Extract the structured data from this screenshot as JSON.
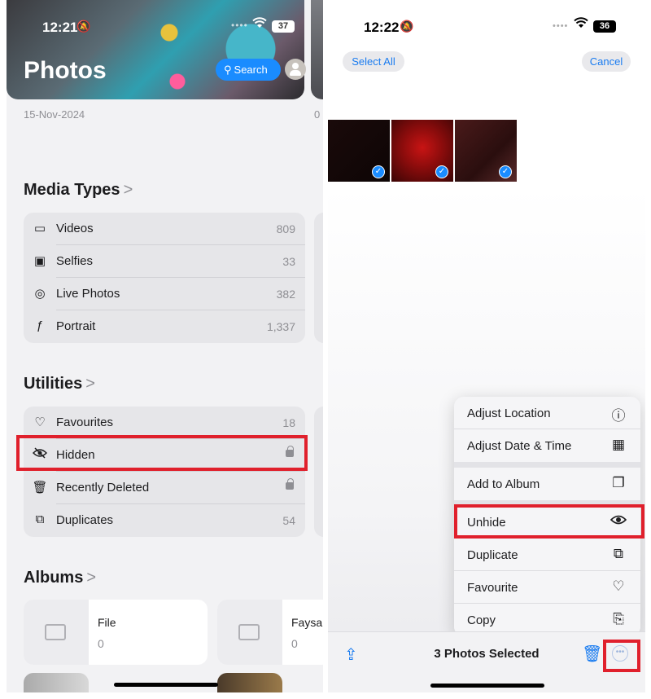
{
  "left": {
    "status_time": "12:21",
    "status_battery": "37",
    "title": "Photos",
    "search_label": "Search",
    "date_left": "15-Nov-2024",
    "date_right": "0",
    "media_types": {
      "title": "Media Types",
      "chevron": ">",
      "items": [
        {
          "label": "Videos",
          "value": "809",
          "icon": "video-icon"
        },
        {
          "label": "Selfies",
          "value": "33",
          "icon": "selfie-icon"
        },
        {
          "label": "Live Photos",
          "value": "382",
          "icon": "live-photo-icon"
        },
        {
          "label": "Portrait",
          "value": "1,337",
          "icon": "portrait-icon"
        }
      ]
    },
    "utilities": {
      "title": "Utilities",
      "chevron": ">",
      "items": [
        {
          "label": "Favourites",
          "value": "18",
          "icon": "heart-icon"
        },
        {
          "label": "Hidden",
          "value": "",
          "icon": "eye-slash-icon"
        },
        {
          "label": "Recently Deleted",
          "value": "",
          "icon": "trash-icon"
        },
        {
          "label": "Duplicates",
          "value": "54",
          "icon": "duplicate-icon"
        }
      ]
    },
    "albums": {
      "title": "Albums",
      "chevron": ">",
      "items": [
        {
          "name": "File",
          "count": "0"
        },
        {
          "name": "Faysal",
          "count": "0"
        }
      ]
    }
  },
  "right": {
    "status_time": "12:22",
    "status_battery": "36",
    "select_all": "Select All",
    "cancel": "Cancel",
    "menu": [
      {
        "label": "Adjust Location",
        "icon": "location-info-icon"
      },
      {
        "label": "Adjust Date & Time",
        "icon": "calendar-icon"
      },
      {
        "label": "Add to Album",
        "icon": "add-album-icon"
      },
      {
        "label": "Unhide",
        "icon": "eye-icon"
      },
      {
        "label": "Duplicate",
        "icon": "duplicate-icon"
      },
      {
        "label": "Favourite",
        "icon": "heart-icon"
      },
      {
        "label": "Copy",
        "icon": "copy-icon"
      }
    ],
    "selected_label": "3 Photos Selected"
  },
  "colors": {
    "accent": "#1a8cff",
    "highlight": "#e0202c"
  }
}
